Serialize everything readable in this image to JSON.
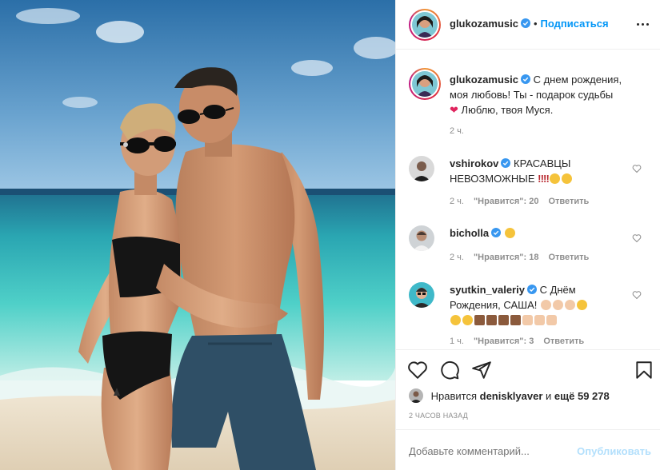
{
  "post": {
    "author": "glukozamusic",
    "follow_label": "Подписаться",
    "separator": "•",
    "caption": "С днем рождения, моя любовь! Ты - подарок судьбы ❤️ Люблю, твоя Муся.",
    "caption_line1": "С днем рождения,",
    "caption_line2": "моя любовь! Ты - подарок судьбы",
    "caption_heart": "❤",
    "caption_line3": "Люблю, твоя Муся.",
    "caption_time": "2 ч."
  },
  "comments": [
    {
      "username": "vshirokov",
      "verified": true,
      "text_line1": "КРАСАВЦЫ",
      "text_line2": "НЕВОЗМОЖНЫЕ",
      "time": "2 ч.",
      "likes": "\"Нравится\": 20",
      "reply": "Ответить"
    },
    {
      "username": "bicholla",
      "verified": true,
      "text": "",
      "time": "2 ч.",
      "likes": "\"Нравится\": 18",
      "reply": "Ответить"
    },
    {
      "username": "syutkin_valeriy",
      "verified": true,
      "text_line1": "С Днём",
      "text_line2": "Рождения, САША!",
      "time": "1 ч.",
      "likes": "\"Нравится\": 3",
      "reply": "Ответить"
    }
  ],
  "likes": {
    "prefix": "Нравится",
    "user": "denisklyaver",
    "connector": "и",
    "others": "ещё 59 278"
  },
  "posted_ago": "2 ЧАСОВ НАЗАД",
  "composer": {
    "placeholder": "Добавьте комментарий...",
    "publish": "Опубликовать"
  },
  "icons": {
    "like": "heart-icon",
    "comment": "comment-icon",
    "share": "share-icon",
    "save": "bookmark-icon",
    "more": "more-icon",
    "verified": "verified-icon"
  },
  "colors": {
    "link": "#0095f6",
    "muted": "#8e8e8e",
    "verified": "#3897f0",
    "heart": "#ed4956",
    "publish_disabled": "#b2dffc"
  }
}
